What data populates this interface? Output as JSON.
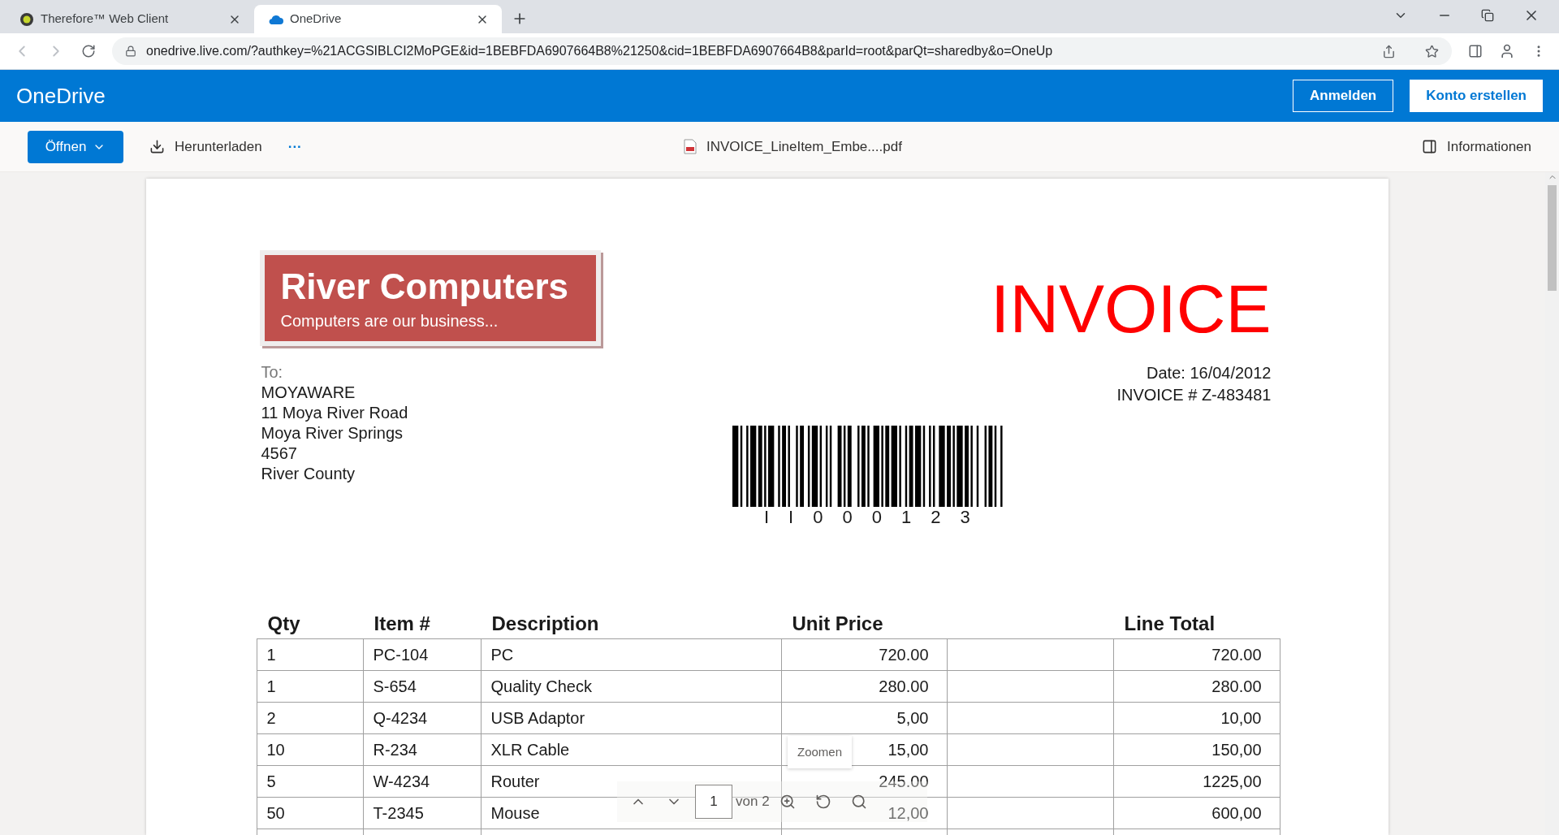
{
  "browser": {
    "tabs": [
      {
        "title": "Therefore™ Web Client",
        "selected": false,
        "kind": "therefore"
      },
      {
        "title": "OneDrive",
        "selected": true,
        "kind": "cloud"
      }
    ],
    "url": "onedrive.live.com/?authkey=%21ACGSIBLCI2MoPGE&id=1BEBFDA6907664B8%21250&cid=1BEBFDA6907664B8&parId=root&parQt=sharedby&o=OneUp"
  },
  "header": {
    "brand": "OneDrive",
    "buttons": [
      {
        "label": "Anmelden",
        "kind": "outline"
      },
      {
        "label": "Konto erstellen",
        "kind": "solid"
      }
    ]
  },
  "command_bar": {
    "open": "Öffnen",
    "download": "Herunterladen",
    "more": "···",
    "file_name": "INVOICE_LineItem_Embe....pdf",
    "info": "Informationen"
  },
  "document": {
    "company": "River Computers",
    "tagline": "Computers are our business...",
    "title": "INVOICE",
    "to_label": "To:",
    "address": [
      "MOYAWARE",
      "11 Moya River Road",
      "Moya River Springs",
      "4567",
      "River County"
    ],
    "date": "Date: 16/04/2012",
    "invoice_number": "INVOICE # Z-483481",
    "barcode_text": "II000123",
    "table": {
      "columns": [
        "Qty",
        "Item #",
        "Description",
        "Unit Price",
        "Line Total"
      ],
      "rows": [
        [
          "1",
          "PC-104",
          "PC",
          "720.00",
          "720.00"
        ],
        [
          "1",
          "S-654",
          "Quality Check",
          "280.00",
          "280.00"
        ],
        [
          "2",
          "Q-4234",
          "USB Adaptor",
          "5,00",
          "10,00"
        ],
        [
          "10",
          "R-234",
          "XLR Cable",
          "15,00",
          "150,00"
        ],
        [
          "5",
          "W-4234",
          "Router",
          "245.00",
          "1225,00"
        ],
        [
          "50",
          "T-2345",
          "Mouse",
          "12,00",
          "600,00"
        ]
      ]
    }
  },
  "pdf_toolbar": {
    "page": "1",
    "page_total": "von 2",
    "tooltip": "Zoomen"
  }
}
